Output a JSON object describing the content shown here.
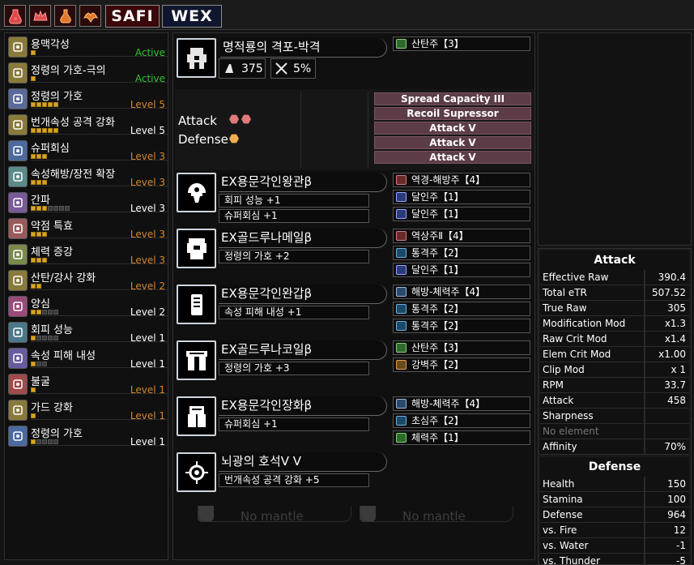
{
  "topbar": {
    "icons": [
      "fire-bottle-icon",
      "crown-icon",
      "potion-icon",
      "wyvern-icon"
    ],
    "tags": [
      "SAFI",
      "WEX"
    ]
  },
  "skills": [
    {
      "name": "용맥각성",
      "level": "Active",
      "filled": 1,
      "total": 1,
      "color": "green"
    },
    {
      "name": "정령의 가호-극의",
      "level": "Active",
      "filled": 1,
      "total": 1,
      "color": "green"
    },
    {
      "name": "정령의 가호",
      "level": "Level 5",
      "filled": 5,
      "total": 5,
      "color": "orange"
    },
    {
      "name": "번개속성 공격 강화",
      "level": "Level 5",
      "filled": 5,
      "total": 5,
      "color": "white"
    },
    {
      "name": "슈퍼회심",
      "level": "Level 3",
      "filled": 3,
      "total": 3,
      "color": "orange"
    },
    {
      "name": "속성해방/장전 확장",
      "level": "Level 3",
      "filled": 3,
      "total": 3,
      "color": "orange"
    },
    {
      "name": "간파",
      "level": "Level 3",
      "filled": 3,
      "total": 7,
      "color": "white"
    },
    {
      "name": "약점 특효",
      "level": "Level 3",
      "filled": 3,
      "total": 3,
      "color": "orange"
    },
    {
      "name": "체력 증강",
      "level": "Level 3",
      "filled": 3,
      "total": 3,
      "color": "orange"
    },
    {
      "name": "산탄/강사 강화",
      "level": "Level 2",
      "filled": 2,
      "total": 2,
      "color": "orange"
    },
    {
      "name": "양심",
      "level": "Level 2",
      "filled": 2,
      "total": 5,
      "color": "white"
    },
    {
      "name": "회피 성능",
      "level": "Level 1",
      "filled": 1,
      "total": 5,
      "color": "white"
    },
    {
      "name": "속성 피해 내성",
      "level": "Level 1",
      "filled": 1,
      "total": 3,
      "color": "white"
    },
    {
      "name": "불굴",
      "level": "Level 1",
      "filled": 1,
      "total": 1,
      "color": "orange"
    },
    {
      "name": "가드 강화",
      "level": "Level 1",
      "filled": 1,
      "total": 1,
      "color": "orange"
    },
    {
      "name": "정령의 가호",
      "level": "Level 1",
      "filled": 1,
      "total": 5,
      "color": "white"
    }
  ],
  "weapon": {
    "name": "명적룡의 격포-박격",
    "attack": "375",
    "affinity": "5%",
    "deco": "산탄주【3】",
    "mods": [
      "Spread Capacity III",
      "Recoil Supressor",
      "Attack V",
      "Attack V",
      "Attack V"
    ],
    "attack_label": "Attack",
    "defense_label": "Defense"
  },
  "armor": [
    {
      "name": "EX용문각인왕관β",
      "skills": [
        "회피 성능 +1",
        "슈퍼회심 +1"
      ],
      "decos": [
        "역경-해방주【4】",
        "달인주【1】",
        "달인주【1】"
      ],
      "icon": "helm-icon"
    },
    {
      "name": "EX골드루나메일β",
      "skills": [
        "정령의 가호 +2"
      ],
      "decos": [
        "역상주Ⅱ【4】",
        "통격주【2】",
        "달인주【1】"
      ],
      "icon": "chest-icon"
    },
    {
      "name": "EX용문각인완갑β",
      "skills": [
        "속성 피해 내성 +1"
      ],
      "decos": [
        "해방-체력주【4】",
        "통격주【2】",
        "통격주【2】"
      ],
      "icon": "arm-icon"
    },
    {
      "name": "EX골드루나코일β",
      "skills": [
        "정령의 가호 +3"
      ],
      "decos": [
        "산탄주【3】",
        "강벽주【2】"
      ],
      "icon": "waist-icon"
    },
    {
      "name": "EX용문각인장화β",
      "skills": [
        "슈퍼회심 +1"
      ],
      "decos": [
        "해방-체력주【4】",
        "초심주【2】",
        "체력주【1】"
      ],
      "icon": "leg-icon"
    }
  ],
  "talisman": {
    "name": "뇌광의 호석Ⅴ Ⅴ",
    "skills": [
      "번개속성 공격 강화 +5"
    ],
    "icon": "talisman-icon"
  },
  "mantles": [
    "No mantle",
    "No mantle"
  ],
  "attack_stats": {
    "title": "Attack",
    "rows": [
      {
        "name": "Effective Raw",
        "value": "390.4"
      },
      {
        "name": "Total eTR",
        "value": "507.52"
      },
      {
        "name": "True Raw",
        "value": "305"
      },
      {
        "name": "Modification Mod",
        "value": "x1.3"
      },
      {
        "name": "Raw Crit Mod",
        "value": "x1.4"
      },
      {
        "name": "Elem Crit Mod",
        "value": "x1.00"
      },
      {
        "name": "Clip Mod",
        "value": "x 1"
      },
      {
        "name": "RPM",
        "value": "33.7"
      },
      {
        "name": "Attack",
        "value": "458"
      },
      {
        "name": "Sharpness",
        "value": ""
      },
      {
        "name": "No element",
        "value": ""
      },
      {
        "name": "Affinity",
        "value": "70%"
      }
    ]
  },
  "defense_stats": {
    "title": "Defense",
    "rows": [
      {
        "name": "Health",
        "value": "150"
      },
      {
        "name": "Stamina",
        "value": "100"
      },
      {
        "name": "Defense",
        "value": "964"
      },
      {
        "name": "vs. Fire",
        "value": "12"
      },
      {
        "name": "vs. Water",
        "value": "-1"
      },
      {
        "name": "vs. Thunder",
        "value": "-5"
      }
    ]
  },
  "colors": {
    "accent_orange": "#d6862a",
    "active_green": "#33c233",
    "mod_bg": "#5c3d47",
    "pip_on": "#d9a521"
  }
}
